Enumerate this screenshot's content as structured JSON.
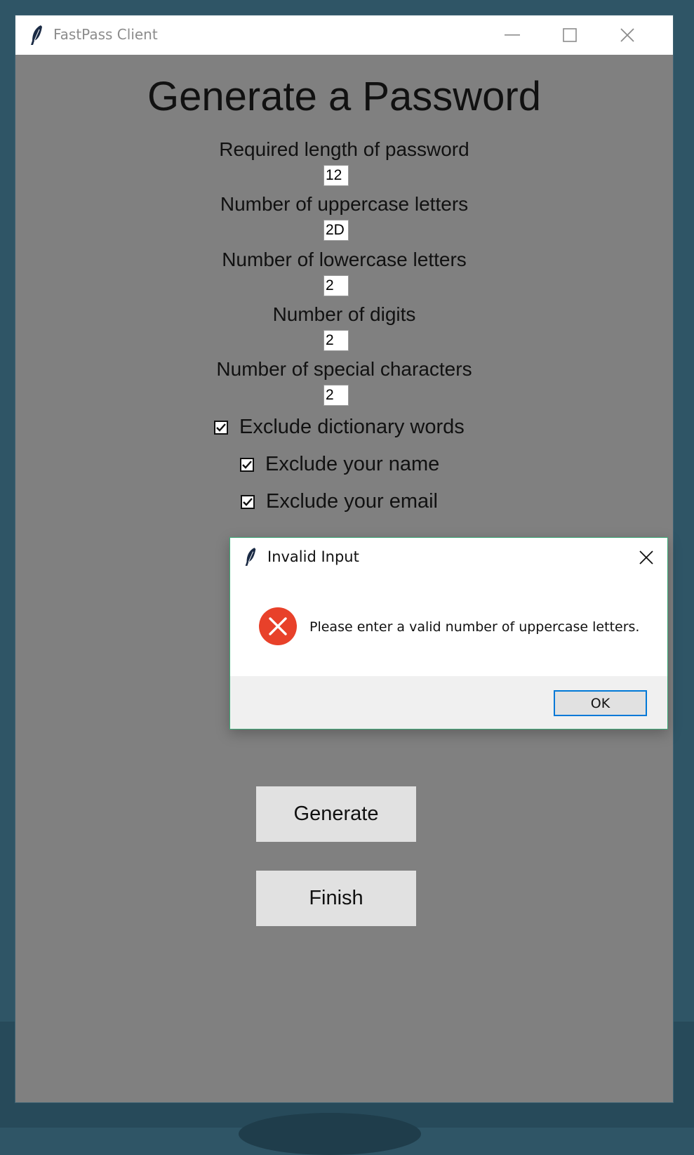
{
  "window": {
    "title": "FastPass Client",
    "icon": "feather-icon",
    "controls": [
      "minimize-icon",
      "maximize-icon",
      "close-icon"
    ]
  },
  "form": {
    "heading": "Generate a Password",
    "fields": [
      {
        "label": "Required length of password",
        "value": "12"
      },
      {
        "label": "Number of uppercase letters",
        "value": "2D"
      },
      {
        "label": "Number of lowercase letters",
        "value": "2"
      },
      {
        "label": "Number of digits",
        "value": "2"
      },
      {
        "label": "Number of special characters",
        "value": "2"
      }
    ],
    "checkboxes": [
      {
        "label": "Exclude dictionary words",
        "checked": true
      },
      {
        "label": "Exclude your name",
        "checked": true
      },
      {
        "label": "Exclude your email",
        "checked": true
      }
    ],
    "generate_label": "Generate",
    "finish_label": "Finish"
  },
  "dialog": {
    "title": "Invalid Input",
    "icon": "error-icon",
    "message": "Please enter a valid number of uppercase letters.",
    "ok_label": "OK"
  },
  "colors": {
    "desktop": "#2f5566",
    "window_bg": "#808080",
    "button_bg": "#e1e1e1",
    "error_red": "#e8412a",
    "focus_blue": "#0078d7"
  }
}
